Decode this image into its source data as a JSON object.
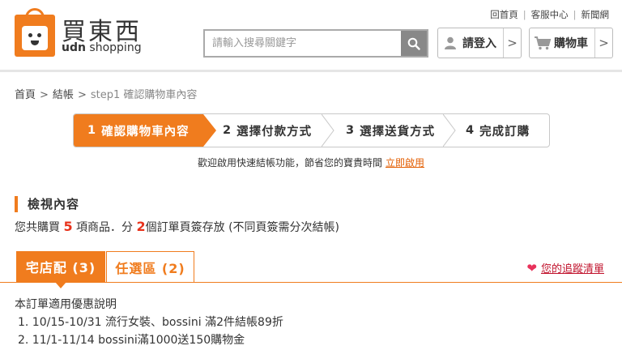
{
  "brand": {
    "name_cn": "買東西",
    "name_en_bold": "udn",
    "name_en": " shopping"
  },
  "toplinks": [
    "回首頁",
    "客服中心",
    "新聞網"
  ],
  "search": {
    "placeholder": "請輸入搜尋關鍵字"
  },
  "header_buttons": {
    "login": "請登入",
    "cart": "購物車"
  },
  "breadcrumb": [
    "首頁",
    "結帳",
    "step1 確認購物車內容"
  ],
  "steps": [
    {
      "num": "1",
      "label": "確認購物車內容",
      "active": true
    },
    {
      "num": "2",
      "label": "選擇付款方式",
      "active": false
    },
    {
      "num": "3",
      "label": "選擇送貨方式",
      "active": false
    },
    {
      "num": "4",
      "label": "完成訂購",
      "active": false
    }
  ],
  "welcome": {
    "text": "歡迎啟用快速結帳功能，節省您的寶貴時間",
    "link": "立即啟用"
  },
  "section": {
    "title": "檢視內容",
    "sub_a": "您共購買 ",
    "item_count": "5",
    "sub_b": " 項商品．分 ",
    "order_count": "2",
    "sub_c": "個訂單頁簽存放 (不同頁簽需分次結帳)"
  },
  "tabs": [
    {
      "label": "宅店配 (3)",
      "active": true
    },
    {
      "label": "任選區 (2)",
      "active": false
    }
  ],
  "wishlist": "您的追蹤清單",
  "promo": {
    "title": "本訂單適用優惠說明",
    "items": [
      "1. 10/15-10/31 流行女裝、bossini 滿2件結帳89折",
      "2. 11/1-11/14 bossini滿1000送150購物金"
    ]
  },
  "colors": {
    "accent": "#f07c1e",
    "link": "#e35d00",
    "highlight": "#e8321b",
    "wish": "#c0112b"
  },
  "icons": [
    "search-icon",
    "user-icon",
    "cart-icon",
    "chevron-right-icon",
    "heart-icon"
  ]
}
